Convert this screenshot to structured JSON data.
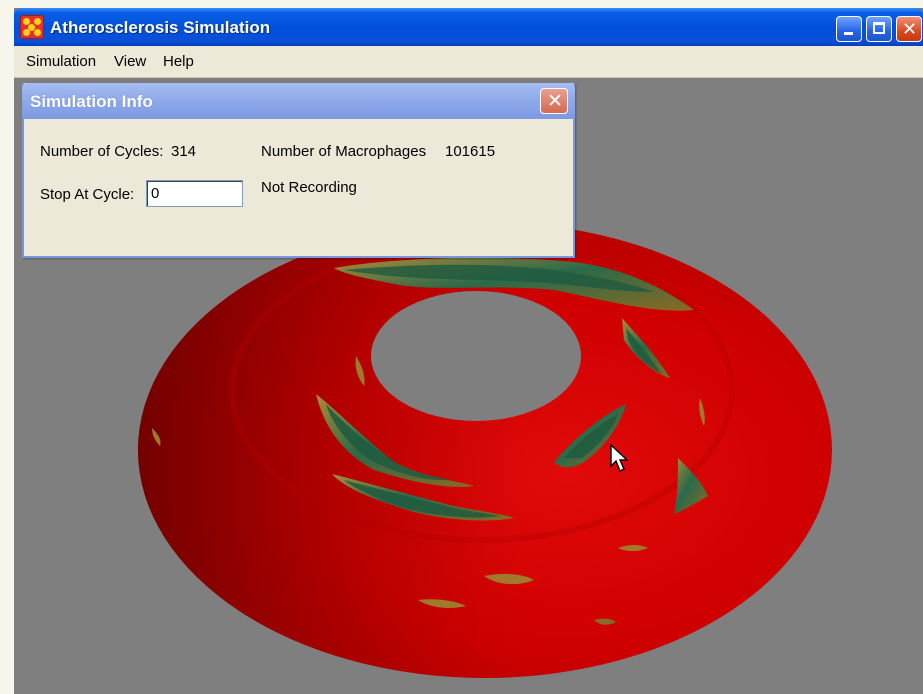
{
  "window": {
    "title": "Atherosclerosis Simulation",
    "app_icon": "atom-app-icon",
    "controls": [
      "minimize-icon",
      "maximize-icon",
      "close-icon"
    ]
  },
  "menu": {
    "items": [
      {
        "label": "Simulation"
      },
      {
        "label": "View"
      },
      {
        "label": "Help"
      }
    ]
  },
  "sim_info": {
    "title": "Simulation Info",
    "cycles_label": "Number of Cycles:",
    "cycles_value": "314",
    "macrophages_label": "Number of Macrophages",
    "macrophages_value": "101615",
    "stop_at_label": "Stop At Cycle:",
    "stop_at_value": "0",
    "recording_status": "Not Recording"
  },
  "colors": {
    "title_bar": "#0050dd",
    "artery_wall": "#cc0000",
    "plaque": "#1f5a40",
    "plaque_edge": "#a0792a",
    "viewport_bg": "#7f7f7f",
    "dialog_bg": "#ece9d8"
  }
}
